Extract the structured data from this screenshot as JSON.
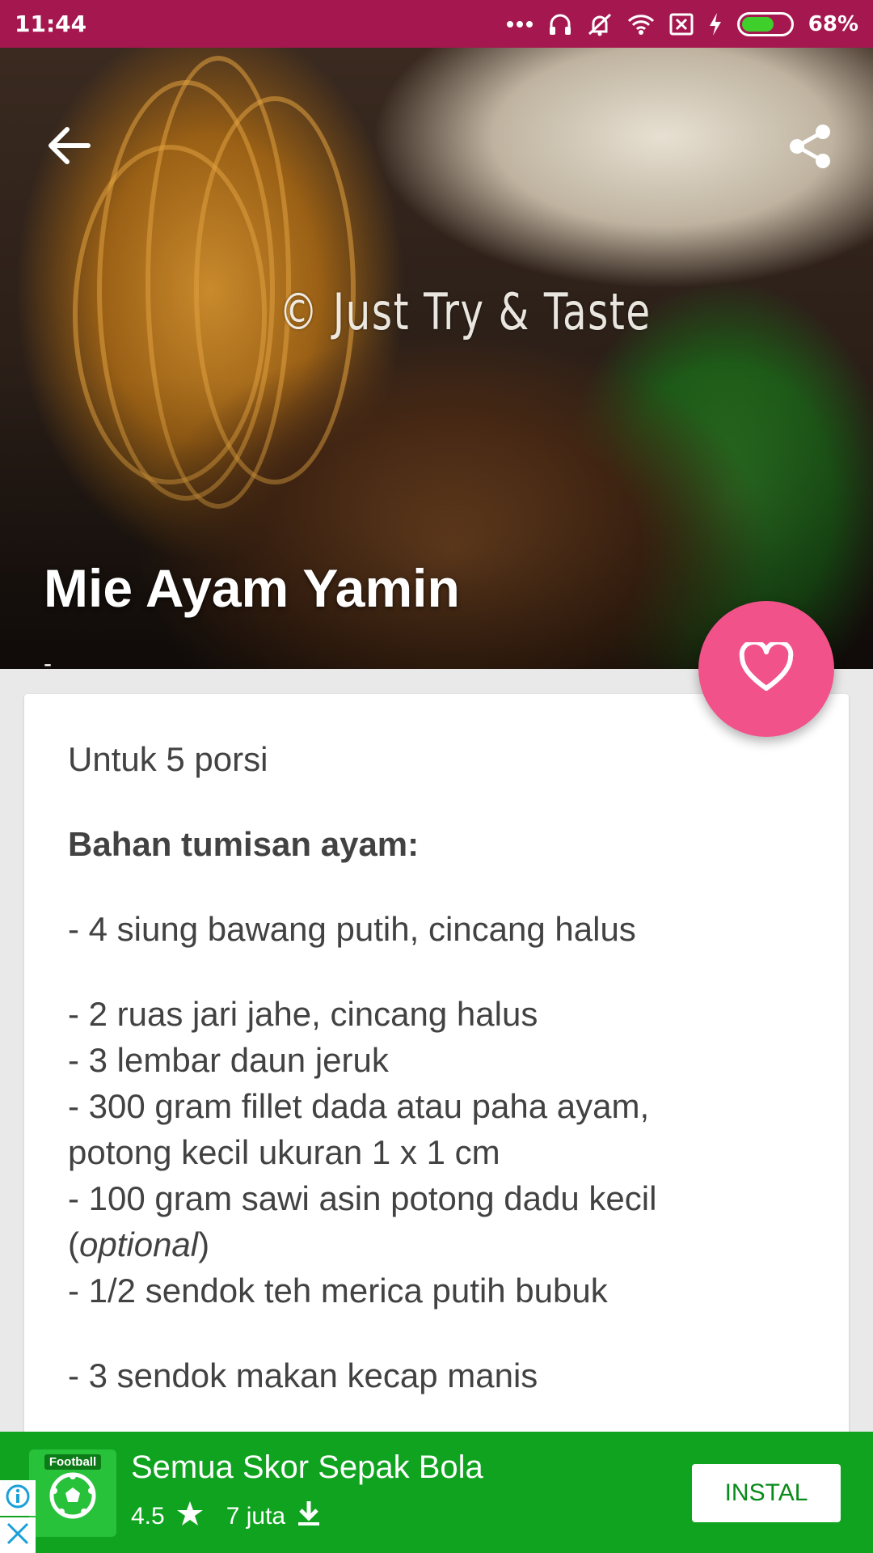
{
  "status_bar": {
    "time": "11:44",
    "battery_percent_label": "68%",
    "battery_level": 0.68,
    "icons": [
      "more-dots-icon",
      "headset-icon",
      "vibrate-off-icon",
      "wifi-icon",
      "no-sim-icon",
      "charging-icon",
      "battery-icon"
    ]
  },
  "hero": {
    "watermark": "© Just Try & Taste",
    "title": "Mie Ayam Yamin",
    "subtitle": "-",
    "icons": {
      "back": "arrow-back-icon",
      "share": "share-icon",
      "favorite": "heart-outline-icon"
    }
  },
  "recipe": {
    "servings": "Untuk 5 porsi",
    "section_heading": "Bahan tumisan ayam:",
    "item_1": "- 4 siung bawang putih, cincang halus",
    "item_2": "- 2 ruas jari jahe, cincang halus",
    "item_3": "- 3 lembar daun jeruk",
    "item_4_line1": "- 300 gram fillet dada atau paha ayam,",
    "item_4_line2": "potong kecil ukuran 1 x 1 cm",
    "item_5_line1": "- 100 gram sawi asin potong dadu kecil",
    "item_5_paren_open": "(",
    "item_5_italic": "optional",
    "item_5_paren_close": ")",
    "item_6": "- 1/2 sendok teh merica putih bubuk",
    "item_7": "- 3 sendok makan kecap manis"
  },
  "ad": {
    "app_icon_label": "Football",
    "title": "Semua Skor Sepak Bola",
    "rating": "4.5",
    "downloads": "7 juta",
    "install_label": "INSTAL",
    "colors": {
      "background": "#0fa31f",
      "install_text": "#0a8a1a"
    }
  },
  "colors": {
    "status_bar": "#a5174f",
    "fab": "#f2528a",
    "body_text": "#424242"
  }
}
